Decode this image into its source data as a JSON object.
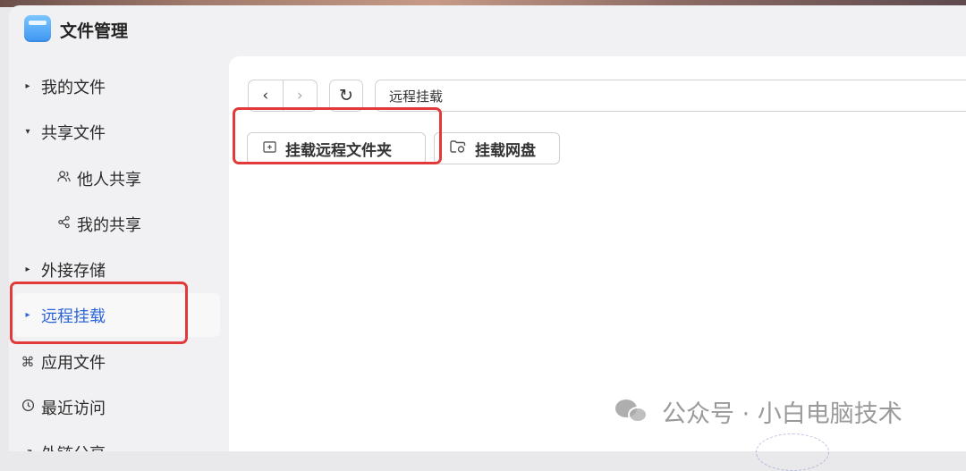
{
  "app": {
    "title": "文件管理",
    "icon": "folder-app-icon"
  },
  "sidebar": {
    "items": [
      {
        "label": "我的文件",
        "icon": "caret-right"
      },
      {
        "label": "共享文件",
        "icon": "caret-down"
      },
      {
        "label": "他人共享",
        "icon": "users-icon"
      },
      {
        "label": "我的共享",
        "icon": "share-icon"
      },
      {
        "label": "外接存储",
        "icon": "caret-right"
      },
      {
        "label": "远程挂载",
        "icon": "caret-right",
        "active": true
      },
      {
        "label": "应用文件",
        "icon": "apps-grid-icon"
      },
      {
        "label": "最近访问",
        "icon": "clock-icon"
      },
      {
        "label": "外链分享",
        "icon": "link-share-icon"
      }
    ]
  },
  "toolbar": {
    "back_icon": "‹",
    "forward_icon": "›",
    "refresh_icon": "↻",
    "path": "远程挂载"
  },
  "actions": {
    "mount_folder_label": "挂载远程文件夹",
    "mount_disk_label": "挂载网盘"
  },
  "watermark": {
    "text": "公众号 · 小白电脑技术"
  },
  "colors": {
    "accent": "#2c64d8",
    "highlight": "#e03a3a"
  }
}
